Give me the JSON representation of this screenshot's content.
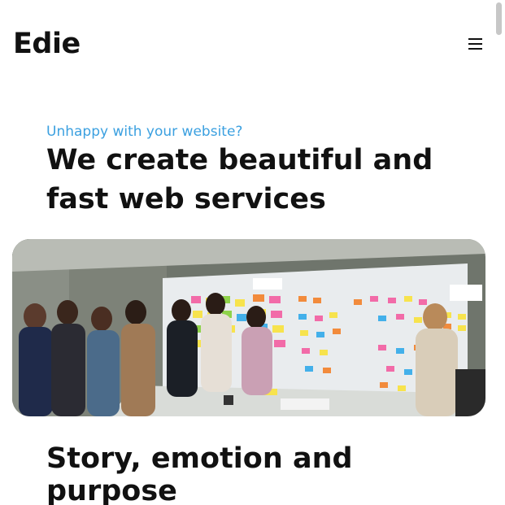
{
  "header": {
    "logo_text": "Edie",
    "menu_icon": "hamburger-menu-icon"
  },
  "hero": {
    "eyebrow": "Unhappy with your website?",
    "headline": "We create beautiful and fast web services",
    "image_alt": "Team members discussing in front of a wall covered with colorful sticky notes"
  },
  "section": {
    "title": "Story, emotion and purpose"
  },
  "colors": {
    "accent": "#3ba0e0",
    "text": "#111111",
    "background": "#ffffff"
  }
}
